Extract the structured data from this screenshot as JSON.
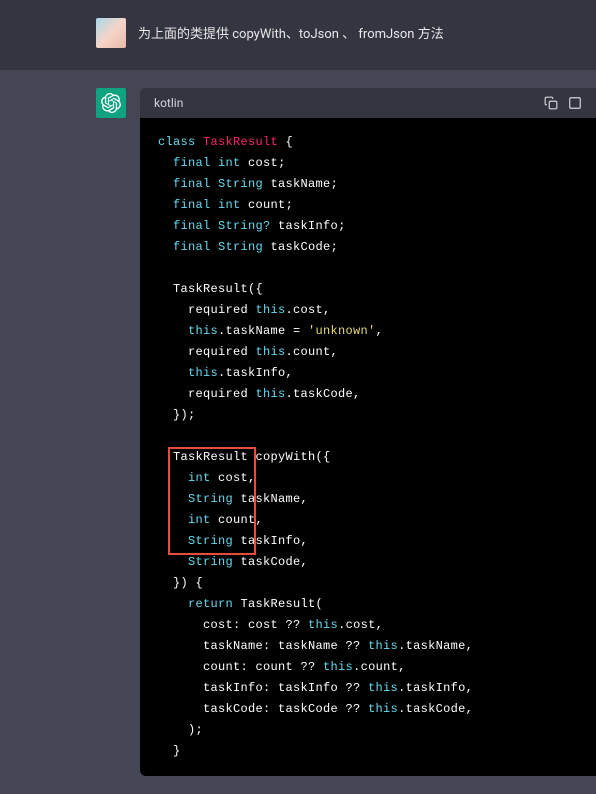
{
  "user": {
    "text": "为上面的类提供 copyWith、toJson 、 fromJson 方法"
  },
  "codeHeader": {
    "language": "kotlin"
  },
  "code": {
    "line1_class": "class",
    "line1_name": "TaskResult",
    "line1_brace": " {",
    "line2_final": "final",
    "line2_type": " int ",
    "line2_name": "cost",
    "line2_semi": ";",
    "line3_final": "final",
    "line3_type": " String ",
    "line3_name": "taskName",
    "line3_semi": ";",
    "line4_final": "final",
    "line4_type": " int ",
    "line4_name": "count",
    "line4_semi": ";",
    "line5_final": "final",
    "line5_type": " String? ",
    "line5_name": "taskInfo",
    "line5_semi": ";",
    "line6_final": "final",
    "line6_type": " String ",
    "line6_name": "taskCode",
    "line6_semi": ";",
    "line8_ctor": "TaskResult({",
    "line9_req": "required",
    "line9_this": " this",
    "line9_rest": ".cost,",
    "line10_this": "this",
    "line10_rest1": ".taskName = ",
    "line10_str": "'unknown'",
    "line10_rest2": ",",
    "line11_req": "required",
    "line11_this": " this",
    "line11_rest": ".count,",
    "line12_this": "this",
    "line12_rest": ".taskInfo,",
    "line13_req": "required",
    "line13_this": " this",
    "line13_rest": ".taskCode,",
    "line14": "});",
    "line16": "TaskResult copyWith({",
    "line17_type": "int ",
    "line17_name": "cost",
    "line17_rest": ",",
    "line18_type": "String ",
    "line18_name": "taskName",
    "line18_rest": ",",
    "line19_type": "int ",
    "line19_name": "count",
    "line19_rest": ",",
    "line20_type": "String ",
    "line20_name": "taskInfo",
    "line20_rest": ",",
    "line21_type": "String ",
    "line21_name": "taskCode",
    "line21_rest": ",",
    "line22": "}) {",
    "line23_ret": "return",
    "line23_rest": " TaskResult(",
    "line24_a": "cost: cost ?? ",
    "line24_this": "this",
    "line24_b": ".cost,",
    "line25_a": "taskName: taskName ?? ",
    "line25_this": "this",
    "line25_b": ".taskName,",
    "line26_a": "count: count ?? ",
    "line26_this": "this",
    "line26_b": ".count,",
    "line27_a": "taskInfo: taskInfo ?? ",
    "line27_this": "this",
    "line27_b": ".taskInfo,",
    "line28_a": "taskCode: taskCode ?? ",
    "line28_this": "this",
    "line28_b": ".taskCode,",
    "line29": ");",
    "line30": "}"
  }
}
